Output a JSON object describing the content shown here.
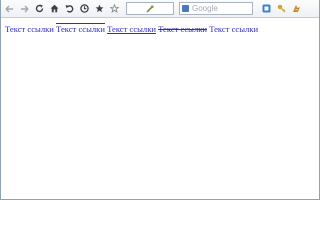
{
  "toolbar": {
    "icons": [
      "back-arrow-icon",
      "forward-arrow-icon",
      "reload-icon",
      "home-icon",
      "undo-icon",
      "history-icon",
      "bookmark-star-icon",
      "bookmark-outline-icon"
    ],
    "search_placeholder": "Google"
  },
  "links": [
    {
      "text": "Текст ссылки",
      "decoration": "none"
    },
    {
      "text": "Текст ссылки",
      "decoration": "overline"
    },
    {
      "text": "Текст ссылки",
      "decoration": "underline"
    },
    {
      "text": "Текст ссылки",
      "decoration": "line-through"
    },
    {
      "text": "Текст ссылки",
      "decoration": "none"
    }
  ],
  "colors": {
    "link": "#2c2cc8",
    "accent": "#4a78c2"
  }
}
